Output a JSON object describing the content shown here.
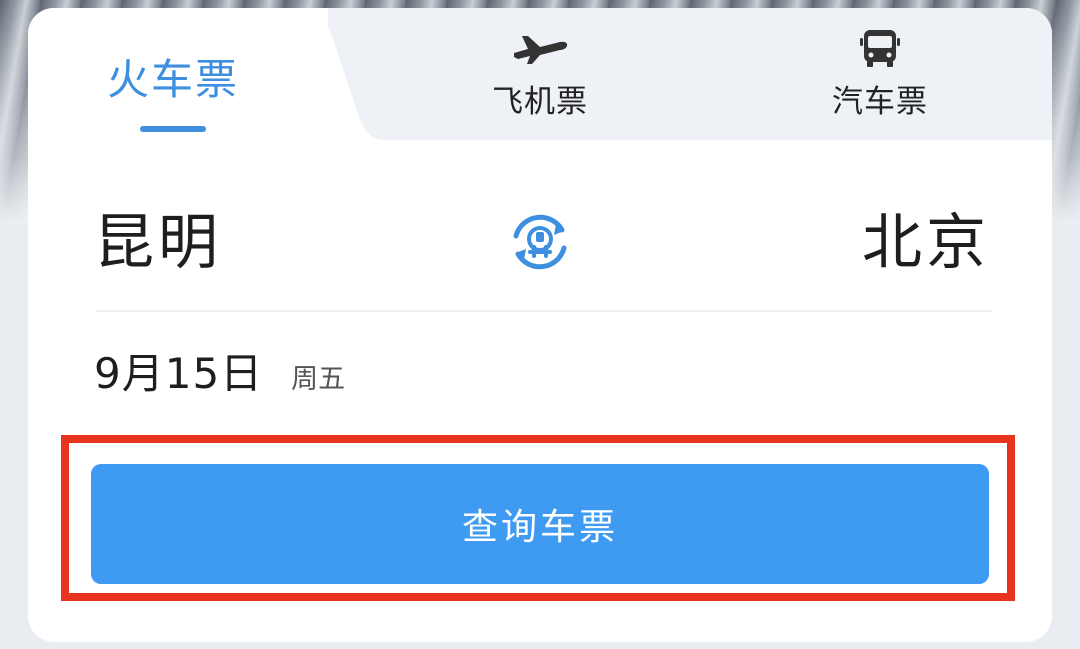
{
  "tabs": {
    "train": {
      "label": "火车票",
      "icon": "train-icon"
    },
    "plane": {
      "label": "飞机票",
      "icon": "airplane-icon"
    },
    "bus": {
      "label": "汽车票",
      "icon": "bus-icon"
    }
  },
  "route": {
    "from": "昆明",
    "to": "北京",
    "swap_icon": "swap-stations-icon"
  },
  "date": {
    "value": "9月15日",
    "weekday": "周五"
  },
  "search": {
    "button_label": "查询车票"
  },
  "colors": {
    "accent": "#3e8fe0",
    "button": "#3f9bf2",
    "highlight": "#e8341c"
  }
}
